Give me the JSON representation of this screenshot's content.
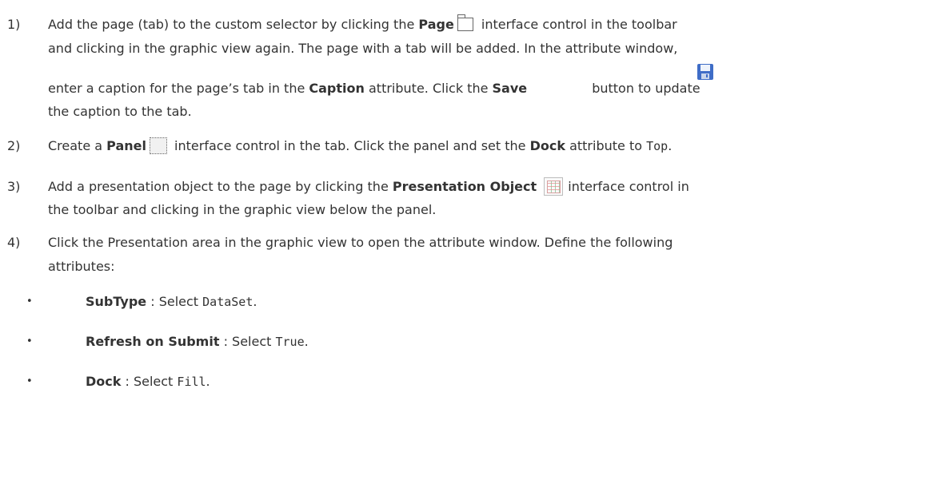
{
  "steps": [
    {
      "number": "1)",
      "l1_a": "Add the page (tab) to the custom selector by clicking the ",
      "l1_page": "Page",
      "l1_b": " interface control in the toolbar",
      "l2": "and clicking in the graphic view again. The page with a tab will be added. In the attribute window,",
      "l3_a": "enter a caption for the page’s tab in the ",
      "l3_caption": "Caption",
      "l3_b": " attribute. Click the ",
      "l3_save": "Save",
      "l3_c": " button to update",
      "l4": "the caption to the tab."
    },
    {
      "number": "2)",
      "l1_a": "Create a ",
      "l1_panel": "Panel",
      "l1_b": " interface control in the tab. Click the panel and set the ",
      "l1_dock": "Dock",
      "l1_c": " attribute to ",
      "l1_value": "Top",
      "l1_d": "."
    },
    {
      "number": "3)",
      "l1_a": "Add a presentation object to the page by clicking the ",
      "l1_po": "Presentation Object",
      "l1_b": " interface control in",
      "l2": "the toolbar and clicking in the graphic view below the panel."
    },
    {
      "number": "4)",
      "l1": "Click the Presentation area in the graphic view to open the attribute window. Define the following",
      "l2": "attributes:"
    }
  ],
  "bullets": [
    {
      "bullet": "•",
      "name": "SubType",
      "sep": " : Select ",
      "value": "DataSet",
      "end": "."
    },
    {
      "bullet": "•",
      "name": "Refresh on Submit",
      "sep": " : Select ",
      "value": "True",
      "end": "."
    },
    {
      "bullet": "•",
      "name": "Dock",
      "sep": " : Select ",
      "value": "Fill",
      "end": "."
    }
  ],
  "icons": {
    "page": "page-tab-icon",
    "save": "save-floppy-icon",
    "panel": "panel-dotted-icon",
    "presentation_object": "presentation-object-grid-icon"
  }
}
